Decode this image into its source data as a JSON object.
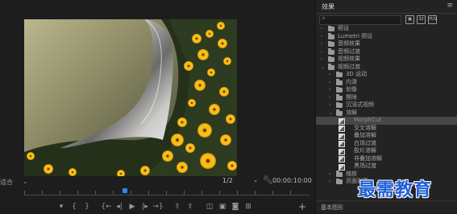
{
  "monitor": {
    "fit_label": "适合",
    "scale_value": "1/2",
    "timecode": "00:00:10:00",
    "transport_icons": [
      "marker-icon",
      "in-point-icon",
      "out-point-icon",
      "go-to-in-icon",
      "step-back-icon",
      "play-icon",
      "step-forward-icon",
      "go-to-out-icon",
      "lift-icon",
      "extract-icon",
      "export-frame-icon",
      "compare-icon",
      "camera-icon",
      "multicam-icon"
    ]
  },
  "effects": {
    "title": "效果",
    "search_placeholder": "",
    "tree": [
      {
        "label": "预设",
        "level": 0,
        "expanded": false,
        "type": "folder"
      },
      {
        "label": "Lumetri 预设",
        "level": 0,
        "expanded": false,
        "type": "folder"
      },
      {
        "label": "音频效果",
        "level": 0,
        "expanded": false,
        "type": "folder"
      },
      {
        "label": "音频过渡",
        "level": 0,
        "expanded": false,
        "type": "folder"
      },
      {
        "label": "视频效果",
        "level": 0,
        "expanded": false,
        "type": "folder"
      },
      {
        "label": "视频过渡",
        "level": 0,
        "expanded": true,
        "type": "folder"
      },
      {
        "label": "3D 运动",
        "level": 1,
        "expanded": false,
        "type": "folder"
      },
      {
        "label": "内滑",
        "level": 1,
        "expanded": false,
        "type": "folder"
      },
      {
        "label": "划像",
        "level": 1,
        "expanded": false,
        "type": "folder"
      },
      {
        "label": "擦除",
        "level": 1,
        "expanded": false,
        "type": "folder"
      },
      {
        "label": "沉浸式视频",
        "level": 1,
        "expanded": false,
        "type": "folder"
      },
      {
        "label": "溶解",
        "level": 1,
        "expanded": true,
        "type": "folder"
      },
      {
        "label": "MorphCut",
        "level": 2,
        "type": "effect",
        "selected": true
      },
      {
        "label": "交叉溶解",
        "level": 2,
        "type": "effect"
      },
      {
        "label": "叠加溶解",
        "level": 2,
        "type": "effect"
      },
      {
        "label": "白场过渡",
        "level": 2,
        "type": "effect"
      },
      {
        "label": "胶片溶解",
        "level": 2,
        "type": "effect"
      },
      {
        "label": "非叠加溶解",
        "level": 2,
        "type": "effect"
      },
      {
        "label": "黑场过渡",
        "level": 2,
        "type": "effect"
      },
      {
        "label": "缩放",
        "level": 1,
        "expanded": false,
        "type": "folder"
      },
      {
        "label": "页面剥落",
        "level": 1,
        "expanded": false,
        "type": "folder"
      }
    ],
    "footer_label": "基本图形"
  },
  "watermark": "最需教育",
  "colors": {
    "accent": "#2a8ae6",
    "watermark": "#1f5fd6"
  }
}
